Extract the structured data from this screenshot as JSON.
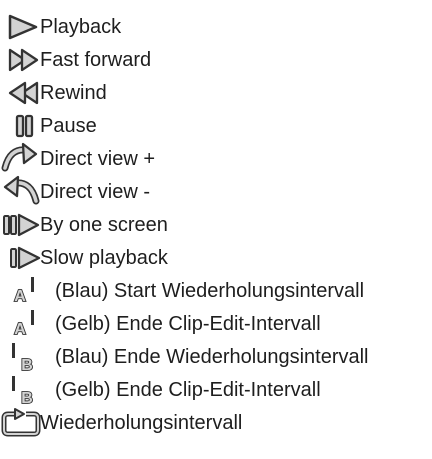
{
  "items": [
    {
      "icon": "play-icon",
      "label": "Playback"
    },
    {
      "icon": "fast-forward-icon",
      "label": "Fast forward"
    },
    {
      "icon": "rewind-icon",
      "label": "Rewind"
    },
    {
      "icon": "pause-icon",
      "label": "Pause"
    },
    {
      "icon": "direct-view-plus-icon",
      "label": "Direct view +"
    },
    {
      "icon": "direct-view-minus-icon",
      "label": "Direct view -"
    },
    {
      "icon": "frame-advance-icon",
      "label": "By one screen"
    },
    {
      "icon": "slow-playback-icon",
      "label": "Slow playback"
    },
    {
      "icon": "marker-a-icon",
      "label": "(Blau) Start Wiederholungsintervall"
    },
    {
      "icon": "marker-a-icon",
      "label": "(Gelb) Ende Clip-Edit-Intervall"
    },
    {
      "icon": "marker-b-icon",
      "label": "(Blau) Ende Wiederholungsintervall"
    },
    {
      "icon": "marker-b-icon",
      "label": "(Gelb) Ende Clip-Edit-Intervall"
    },
    {
      "icon": "repeat-interval-icon",
      "label": "Wiederholungsintervall"
    }
  ]
}
